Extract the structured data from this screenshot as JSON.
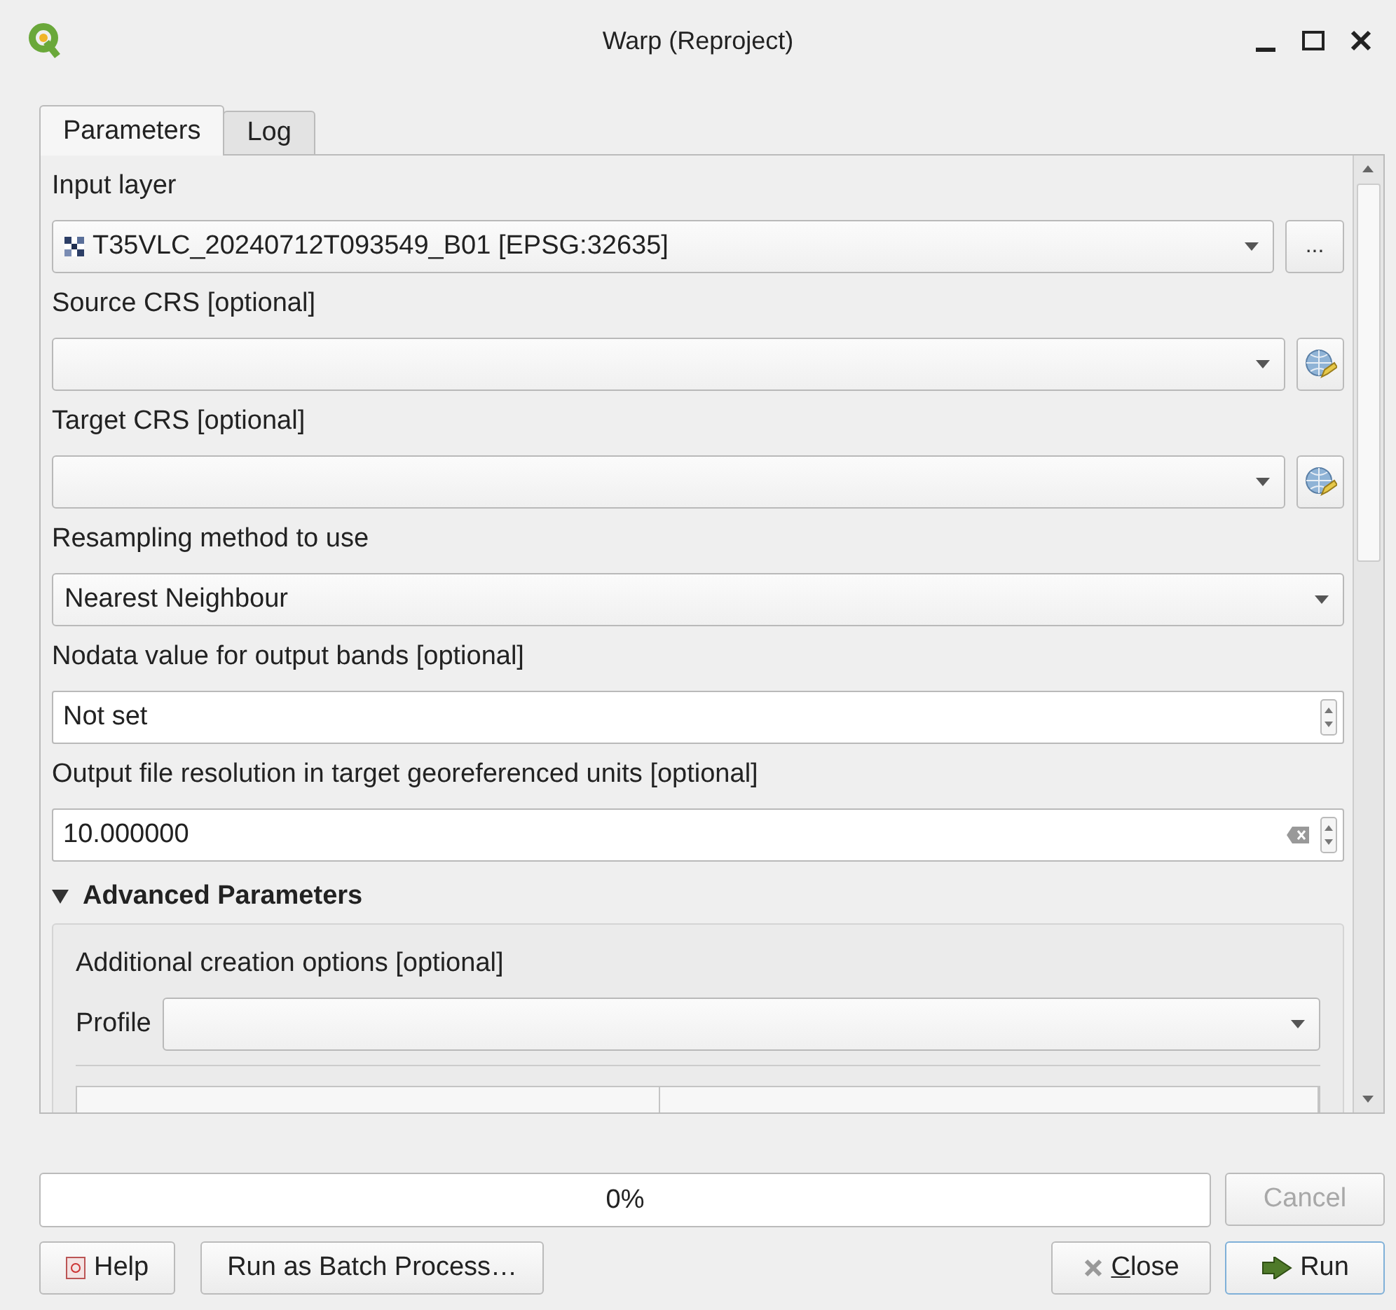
{
  "window": {
    "title": "Warp (Reproject)"
  },
  "tabs": [
    {
      "label": "Parameters",
      "selected": true
    },
    {
      "label": "Log",
      "selected": false
    }
  ],
  "parameters": [
    {
      "kind": "layer",
      "label": "Input layer",
      "value": "T35VLC_20240712T093549_B01 [EPSG:32635]",
      "button": "..."
    },
    {
      "kind": "crs",
      "label": "Source CRS [optional]"
    },
    {
      "kind": "crs",
      "label": "Target CRS [optional]"
    },
    {
      "kind": "combo",
      "label": "Resampling method to use",
      "value": "Nearest Neighbour"
    },
    {
      "kind": "spin",
      "label": "Nodata value for output bands [optional]",
      "value": "Not set"
    },
    {
      "kind": "spin_clear",
      "label": "Output file resolution in target georeferenced units [optional]",
      "value": "10.000000"
    }
  ],
  "advanced": {
    "title": "Advanced Parameters",
    "expanded": true,
    "options_label": "Additional creation options [optional]",
    "profile_label": "Profile"
  },
  "progress": {
    "text": "0%"
  },
  "cancel": {
    "label": "Cancel",
    "disabled": true
  },
  "buttons_left": [
    {
      "kind": "help",
      "label": "Help"
    },
    {
      "kind": "plain",
      "label": "Run as Batch Process…"
    }
  ],
  "buttons_right": [
    {
      "kind": "close",
      "label": "Close"
    },
    {
      "kind": "run",
      "label": "Run"
    }
  ]
}
